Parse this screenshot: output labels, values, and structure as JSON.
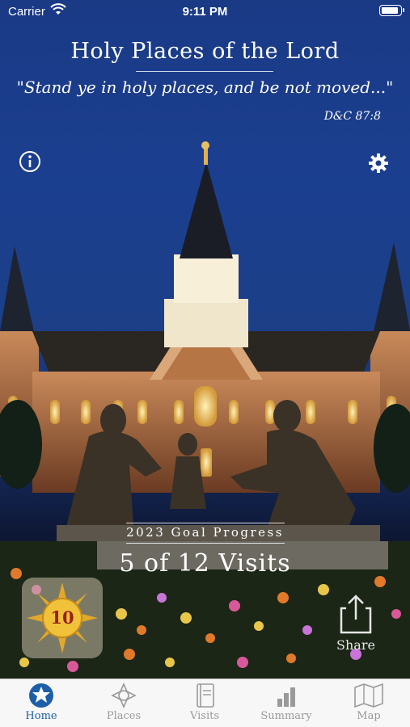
{
  "status_bar": {
    "carrier": "Carrier",
    "time": "9:11 PM"
  },
  "header": {
    "title": "Holy Places of the Lord",
    "quote": "\"Stand ye in holy places, and be not moved...\"",
    "reference": "D&C 87:8"
  },
  "icons": {
    "info": "info-icon",
    "settings": "gear-icon",
    "share": "share-icon"
  },
  "goal": {
    "label": "2023 Goal Progress",
    "value": "5 of 12 Visits",
    "visits": 5,
    "target": 12
  },
  "badge": {
    "number": "10"
  },
  "share": {
    "label": "Share"
  },
  "tabs": [
    {
      "label": "Home",
      "icon": "home-star-icon",
      "active": true
    },
    {
      "label": "Places",
      "icon": "places-icon",
      "active": false
    },
    {
      "label": "Visits",
      "icon": "visits-journal-icon",
      "active": false
    },
    {
      "label": "Summary",
      "icon": "summary-chart-icon",
      "active": false
    },
    {
      "label": "Map",
      "icon": "map-icon",
      "active": false
    }
  ],
  "colors": {
    "tab_active": "#1e5ea8",
    "tab_inactive": "#9a9a9a",
    "sky": "#1b3f8f"
  }
}
